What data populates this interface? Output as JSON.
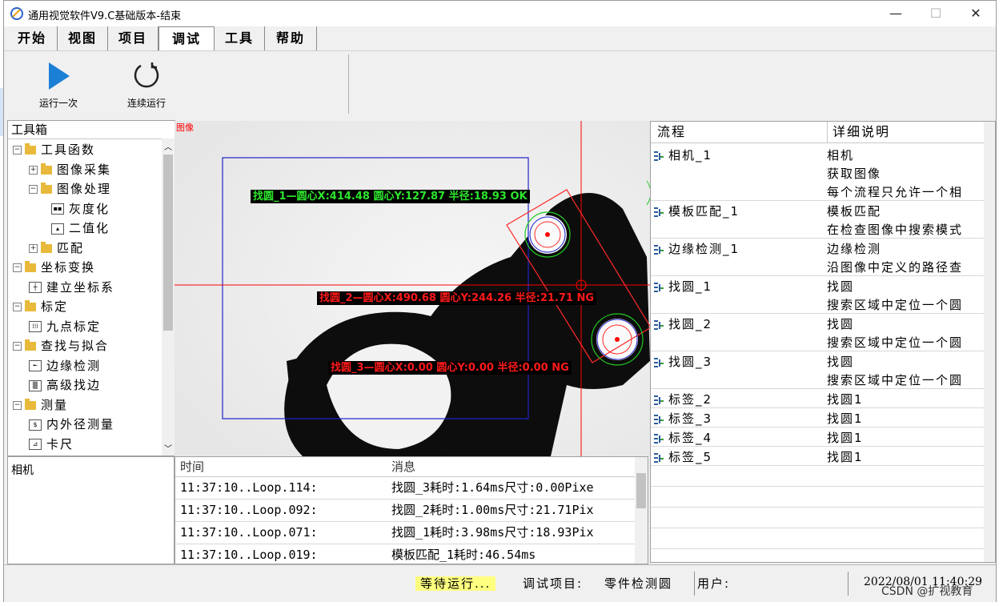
{
  "window": {
    "title": "通用视觉软件V9.C基础版本-结束",
    "minimize": "—",
    "maximize": "☐",
    "close": "✕"
  },
  "menu": [
    "开始",
    "视图",
    "项目",
    "调试",
    "工具",
    "帮助"
  ],
  "menu_active": "调试",
  "ribbon": {
    "run_once": "运行一次",
    "continuous": "连续运行"
  },
  "toolbox": {
    "header": "工具箱",
    "tree": [
      {
        "label": "工具函数",
        "level": 0,
        "exp": "⊟",
        "icon": "folder"
      },
      {
        "label": "图像采集",
        "level": 1,
        "exp": "⊞",
        "icon": "folder"
      },
      {
        "label": "图像处理",
        "level": 1,
        "exp": "⊟",
        "icon": "folder"
      },
      {
        "label": "灰度化",
        "level": 2,
        "icon": "grayscale-icon"
      },
      {
        "label": "二值化",
        "level": 2,
        "icon": "binarize-icon"
      },
      {
        "label": "匹配",
        "level": 1,
        "exp": "⊞",
        "icon": "folder"
      },
      {
        "label": "坐标变换",
        "level": 0,
        "exp": "⊟",
        "icon": "folder"
      },
      {
        "label": "建立坐标系",
        "level": 1,
        "icon": "coordinate-icon"
      },
      {
        "label": "标定",
        "level": 0,
        "exp": "⊟",
        "icon": "folder"
      },
      {
        "label": "九点标定",
        "level": 1,
        "icon": "nine-point-icon"
      },
      {
        "label": "查找与拟合",
        "level": 0,
        "exp": "⊟",
        "icon": "folder"
      },
      {
        "label": "边缘检测",
        "level": 1,
        "icon": "edge-icon"
      },
      {
        "label": "高级找边",
        "level": 1,
        "icon": "advanced-edge-icon"
      },
      {
        "label": "测量",
        "level": 0,
        "exp": "⊟",
        "icon": "folder"
      },
      {
        "label": "内外径测量",
        "level": 1,
        "icon": "diameter-icon"
      },
      {
        "label": "卡尺",
        "level": 1,
        "icon": "caliper-icon"
      }
    ]
  },
  "camera_panel": {
    "label": "相机"
  },
  "image_view": {
    "tag": "图像",
    "labels": [
      {
        "text": "找圆_1—圆心X:414.48 圆心Y:127.87 半径:18.93 OK",
        "status": "ok"
      },
      {
        "text": "找圆_2—圆心X:490.68 圆心Y:244.26 半径:21.71 NG",
        "status": "ng"
      },
      {
        "text": "找圆_3—圆心X:0.00 圆心Y:0.00 半径:0.00 NG",
        "status": "ng"
      }
    ],
    "colors": {
      "ok": "#2ee62e",
      "ng": "#ff1a1a",
      "roi": "#2222cc",
      "crosshair": "#ff0000"
    }
  },
  "log": {
    "columns": [
      "时间",
      "消息"
    ],
    "rows": [
      {
        "time": "11:37:10..Loop.114:",
        "msg": "找圆_3耗时:1.64ms尺寸:0.00Pixe"
      },
      {
        "time": "11:37:10..Loop.092:",
        "msg": "找圆_2耗时:1.00ms尺寸:21.71Pix"
      },
      {
        "time": "11:37:10..Loop.071:",
        "msg": "找圆_1耗时:3.98ms尺寸:18.93Pix"
      },
      {
        "time": "11:37:10..Loop.019:",
        "msg": "模板匹配_1耗时:46.54ms"
      }
    ]
  },
  "flow": {
    "columns": [
      "流程",
      "详细说明"
    ],
    "rows": [
      {
        "name": "相机_1",
        "desc": [
          "相机",
          "获取图像",
          "每个流程只允许一个相"
        ]
      },
      {
        "name": "模板匹配_1",
        "desc": [
          "模板匹配",
          "在检查图像中搜索模式"
        ]
      },
      {
        "name": "边缘检测_1",
        "desc": [
          "边缘检测",
          "沿图像中定义的路径查"
        ]
      },
      {
        "name": "找圆_1",
        "desc": [
          "找圆",
          "搜索区域中定位一个圆"
        ]
      },
      {
        "name": "找圆_2",
        "desc": [
          "找圆",
          "搜索区域中定位一个圆"
        ]
      },
      {
        "name": "找圆_3",
        "desc": [
          "找圆",
          "搜索区域中定位一个圆"
        ]
      },
      {
        "name": "标签_2",
        "desc": [
          "找圆1"
        ]
      },
      {
        "name": "标签_3",
        "desc": [
          "找圆1"
        ]
      },
      {
        "name": "标签_4",
        "desc": [
          "找圆1"
        ]
      },
      {
        "name": "标签_5",
        "desc": [
          "找圆1"
        ]
      }
    ]
  },
  "status": {
    "state": "等待运行...",
    "project_label": "调试项目:",
    "project": "零件检测圆",
    "user_label": "用户:",
    "datetime": "2022/08/01 11:40:29",
    "watermark": "CSDN @扩视教育"
  }
}
